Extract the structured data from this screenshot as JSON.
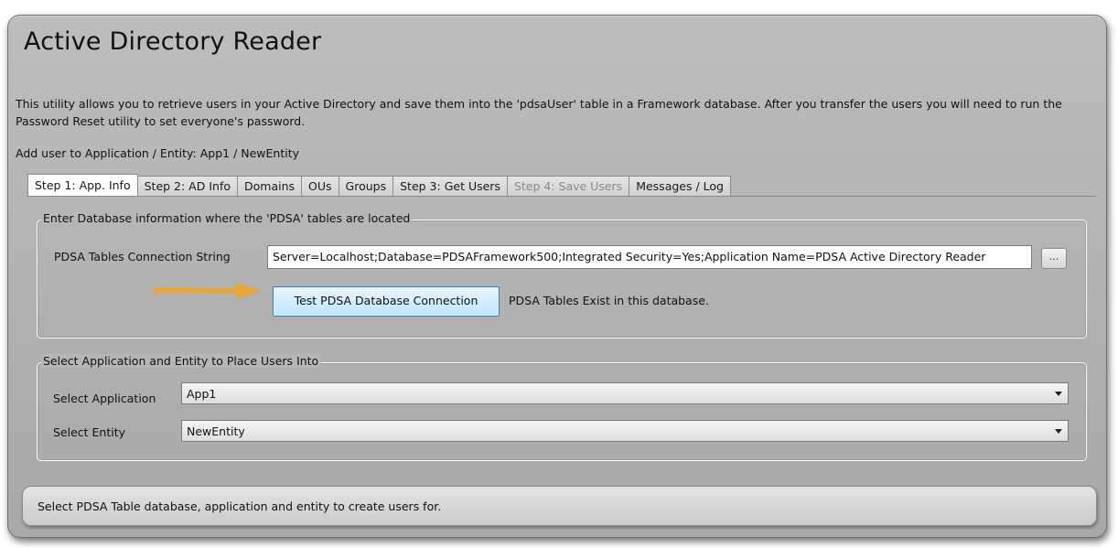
{
  "app": {
    "title": "Active Directory Reader",
    "description": "This utility allows you to retrieve users in your Active Directory and save them into the 'pdsaUser' table in a Framework database. After you transfer the users you will need to run the Password Reset utility to set everyone's password.",
    "add_user_label": "Add user to Application / Entity:",
    "add_user_value": "App1 / NewEntity"
  },
  "tabs": [
    {
      "label": "Step 1: App. Info",
      "state": "active"
    },
    {
      "label": "Step 2: AD Info",
      "state": "normal"
    },
    {
      "label": "Domains",
      "state": "normal"
    },
    {
      "label": "OUs",
      "state": "normal"
    },
    {
      "label": "Groups",
      "state": "normal"
    },
    {
      "label": "Step 3: Get Users",
      "state": "normal"
    },
    {
      "label": "Step 4: Save Users",
      "state": "disabled"
    },
    {
      "label": "Messages / Log",
      "state": "normal"
    }
  ],
  "database_group": {
    "title": "Enter Database information where the 'PDSA' tables are located",
    "connection_label": "PDSA Tables Connection String",
    "connection_value": "Server=Localhost;Database=PDSAFramework500;Integrated Security=Yes;Application Name=PDSA Active Directory Reader",
    "browse_label": "...",
    "test_button_label": "Test PDSA Database Connection",
    "test_result": "PDSA Tables Exist in this database."
  },
  "application_group": {
    "title": "Select Application and Entity to Place Users Into",
    "application_label": "Select Application",
    "application_value": "App1",
    "entity_label": "Select Entity",
    "entity_value": "NewEntity"
  },
  "status_bar": {
    "text": "Select PDSA Table database, application and entity to create users for."
  },
  "colors": {
    "arrow": "#e8a53a",
    "button_border": "#3c7fb1",
    "window_bg": "#b6b6b6"
  },
  "icons": {
    "arrow": "arrow-right-icon",
    "dropdown": "chevron-down-icon"
  }
}
